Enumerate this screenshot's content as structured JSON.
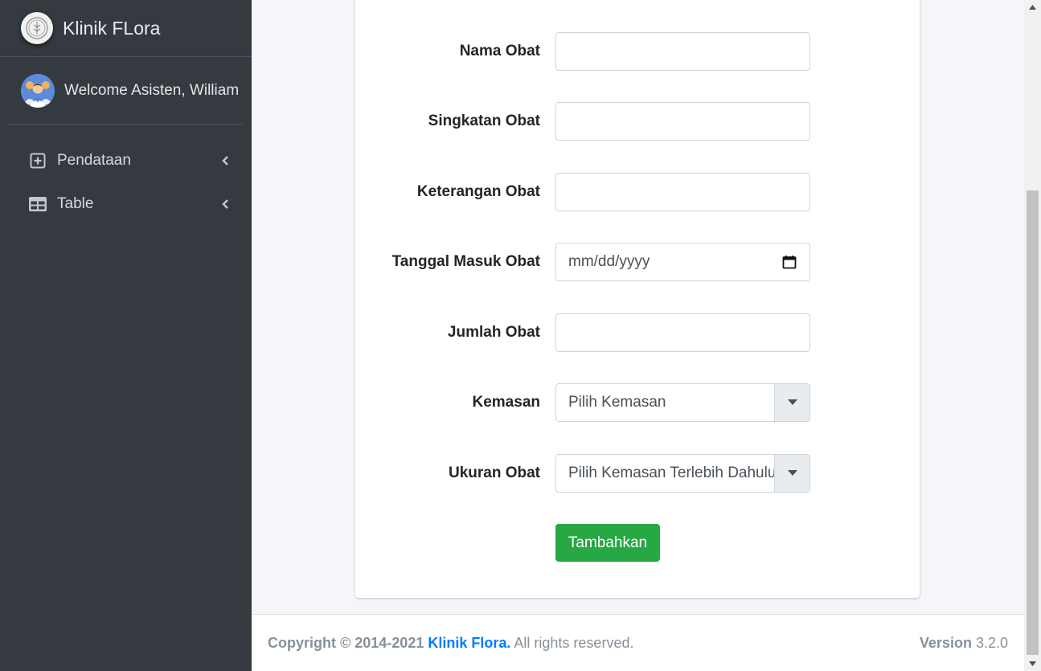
{
  "brand": {
    "name": "Klinik FLora"
  },
  "user": {
    "welcome": "Welcome Asisten, William"
  },
  "sidebar": {
    "items": [
      {
        "label": "Pendataan",
        "icon": "plus-square-icon"
      },
      {
        "label": "Table",
        "icon": "table-icon"
      }
    ]
  },
  "form": {
    "nama_obat": {
      "label": "Nama Obat",
      "value": ""
    },
    "singkatan_obat": {
      "label": "Singkatan Obat",
      "value": ""
    },
    "keterangan_obat": {
      "label": "Keterangan Obat",
      "value": ""
    },
    "tanggal_masuk": {
      "label": "Tanggal Masuk Obat",
      "placeholder": "mm/dd/yyyy"
    },
    "jumlah_obat": {
      "label": "Jumlah Obat",
      "value": ""
    },
    "kemasan": {
      "label": "Kemasan",
      "selected": "Pilih Kemasan"
    },
    "ukuran_obat": {
      "label": "Ukuran Obat",
      "selected": "Pilih Kemasan Terlebih Dahulu"
    },
    "submit_label": "Tambahkan"
  },
  "footer": {
    "copyright_prefix": "Copyright © 2014-2021",
    "brand_link": "Klinik Flora.",
    "rights": "All rights reserved.",
    "version_label": "Version",
    "version_number": "3.2.0"
  },
  "colors": {
    "sidebar_bg": "#343a40",
    "content_bg": "#f4f6f9",
    "submit_green": "#28a745",
    "link_blue": "#007bff"
  }
}
